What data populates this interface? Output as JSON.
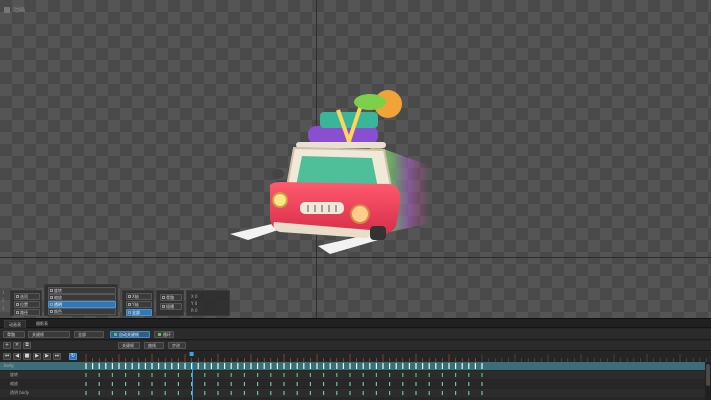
{
  "viewport": {
    "title": "动画"
  },
  "props": {
    "side_numbers": [
      "1",
      "2",
      "3"
    ],
    "group1": {
      "buttons": [
        "选项",
        "位置",
        "路径"
      ]
    },
    "group2": {
      "rows": [
        "旋转",
        "缩放",
        "透明",
        "颜色"
      ]
    },
    "group3": {
      "buttons": [
        "X轴",
        "Y轴",
        "全部"
      ]
    },
    "group4": {
      "buttons": [
        "骨骼",
        "插槽"
      ]
    },
    "group5": {
      "labels": [
        "X  0",
        "Y  0",
        "R  0"
      ]
    }
  },
  "timeline": {
    "tabs": [
      "动画表",
      "摄影表"
    ],
    "toolbar1": {
      "dropdown": "骨骼",
      "mode": "关键帧",
      "filter": "全部",
      "auto_key": "自动关键帧",
      "loop": "循环"
    },
    "toolbar2": {
      "keys": "关键帧",
      "tangent": "曲线",
      "step": "步进"
    },
    "tracks": [
      {
        "name": "body"
      },
      {
        "name": "旋转"
      },
      {
        "name": "缩放"
      },
      {
        "name": "透明 body"
      }
    ],
    "ruler_start": 0,
    "ruler_end": 60,
    "ruler_step": 5,
    "playhead_frame": 16
  }
}
